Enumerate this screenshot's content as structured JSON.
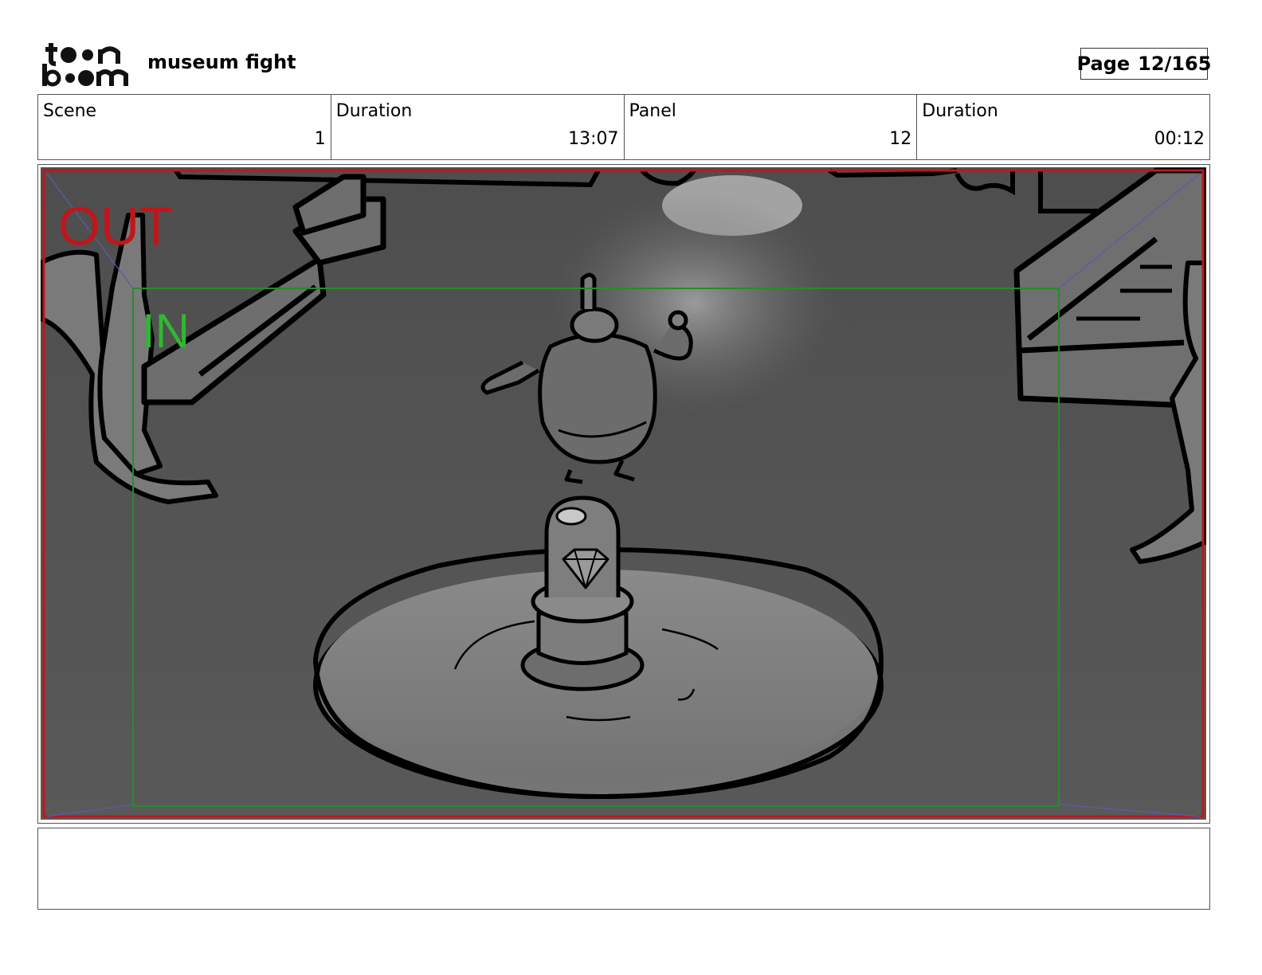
{
  "header": {
    "logo_text": "toon boom",
    "project_title": "museum fight",
    "page_label": "Page",
    "page_number": "12/165"
  },
  "info": {
    "scene_label": "Scene",
    "scene_value": "1",
    "scene_duration_label": "Duration",
    "scene_duration_value": "13:07",
    "panel_label": "Panel",
    "panel_value": "12",
    "panel_duration_label": "Duration",
    "panel_duration_value": "00:12"
  },
  "panel": {
    "out_label": "OUT",
    "in_label": "IN",
    "colors": {
      "out_frame": "#c0161b",
      "in_frame": "#2b8a2b",
      "in_text": "#2fb82f"
    }
  },
  "notes": {
    "text": ""
  }
}
